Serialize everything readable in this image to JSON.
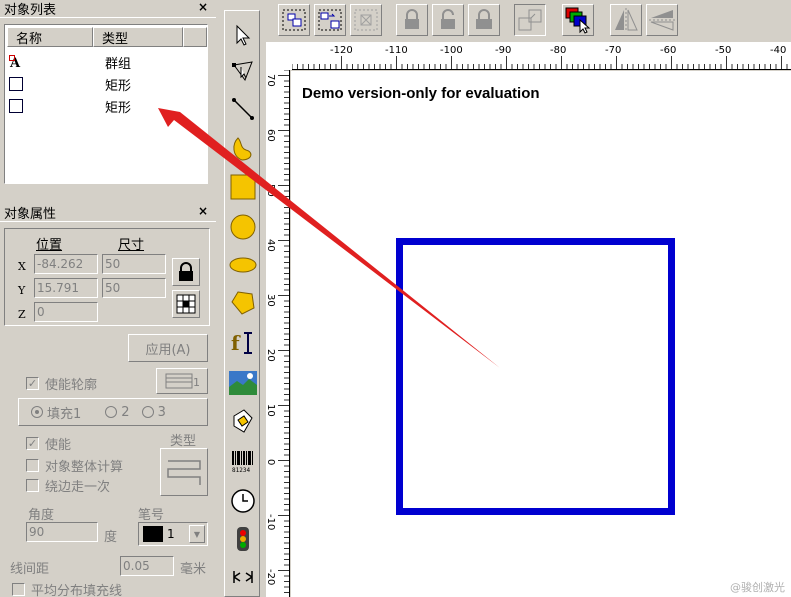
{
  "object_list": {
    "title": "对象列表",
    "close": "×",
    "columns": [
      "名称",
      "类型"
    ],
    "rows": [
      {
        "icon": "group-icon",
        "type": "群组"
      },
      {
        "icon": "rectangle-icon",
        "type": "矩形"
      },
      {
        "icon": "rectangle-icon",
        "type": "矩形"
      }
    ]
  },
  "properties": {
    "title": "对象属性",
    "close": "×",
    "position_label": "位置",
    "size_label": "尺寸",
    "x_label": "X",
    "y_label": "Y",
    "z_label": "Z",
    "x_value": "-84.262",
    "y_value": "15.791",
    "z_value": "0",
    "width_value": "50",
    "height_value": "50",
    "apply_label": "应用(A)",
    "enable_outline": "使能轮廓",
    "fill1": "填充1",
    "fill2": "2",
    "fill3": "3",
    "enable": "使能",
    "type_label": "类型",
    "whole_calc": "对象整体计算",
    "edge_once": "绕边走一次",
    "angle_label": "角度",
    "angle_value": "90",
    "degree_unit": "度",
    "pen_label": "笔号",
    "pen_value": "1",
    "line_spacing_label": "线间距",
    "line_spacing_value": "0.05",
    "mm_unit": "毫米",
    "even_fill": "平均分布填充线"
  },
  "ruler": {
    "h_labels": [
      "-120",
      "-110",
      "-100",
      "-90",
      "-80",
      "-70",
      "-60",
      "-50",
      "-40"
    ],
    "v_labels": [
      "70",
      "60",
      "50",
      "40",
      "30",
      "20",
      "10",
      "0",
      "-10",
      "-20"
    ]
  },
  "canvas": {
    "demo_text": "Demo version-only for evaluation",
    "shape_color": "#0000d0"
  },
  "annotation": {
    "arrow_color": "#e02020"
  },
  "watermark": "@骏创激光"
}
